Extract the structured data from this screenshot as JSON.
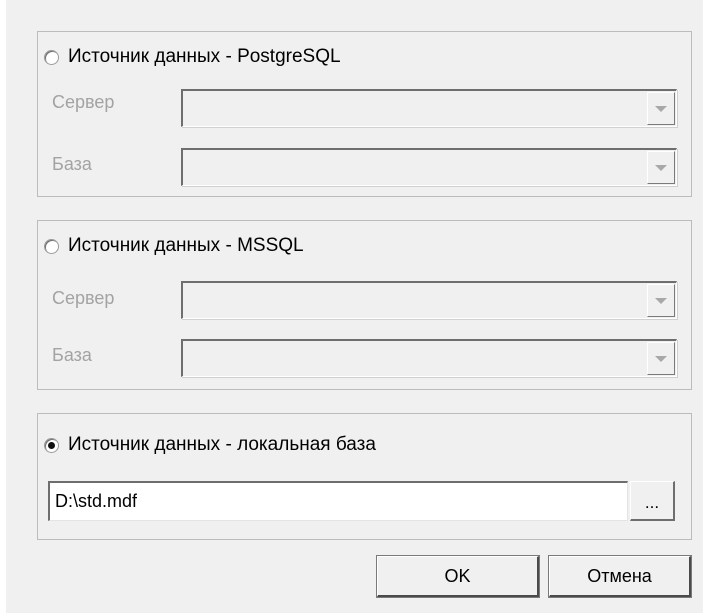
{
  "postgres_group": {
    "radio_label": "Источник данных - PostgreSQL",
    "selected": false,
    "server_label": "Сервер",
    "server_value": "",
    "database_label": "База",
    "database_value": ""
  },
  "mssql_group": {
    "radio_label": "Источник данных - MSSQL",
    "selected": false,
    "server_label": "Сервер",
    "server_value": "",
    "database_label": "База",
    "database_value": ""
  },
  "local_group": {
    "radio_label": "Источник данных - локальная база",
    "selected": true,
    "path_value": "D:\\std.mdf",
    "browse_label": "..."
  },
  "buttons": {
    "ok_label": "OK",
    "cancel_label": "Отмена"
  },
  "icons": {
    "combo_dropdown": "chevron-down-icon",
    "radio": "radio-button-icon"
  },
  "colors": {
    "dialog_background": "#f0f0f0",
    "disabled_text": "#a3a3a3",
    "group_border": "#bcbcbc"
  }
}
